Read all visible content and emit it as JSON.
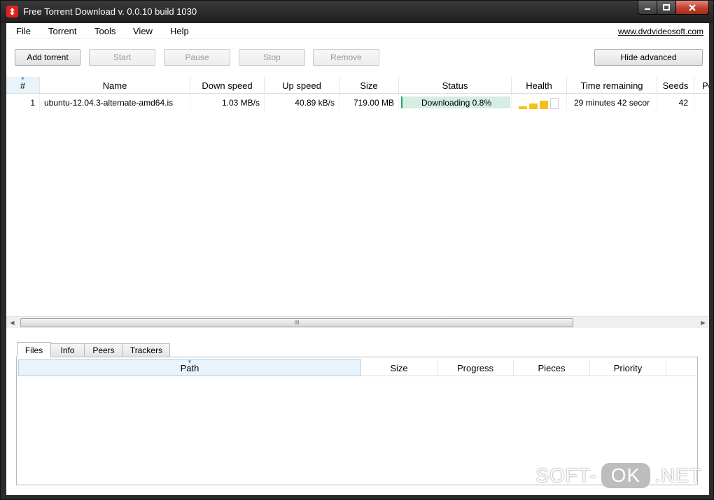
{
  "window": {
    "title": "Free Torrent Download v. 0.0.10 build 1030"
  },
  "menu": {
    "items": [
      "File",
      "Torrent",
      "Tools",
      "View",
      "Help"
    ],
    "site_link": "www.dvdvideosoft.com"
  },
  "toolbar": {
    "add": "Add torrent",
    "start": "Start",
    "pause": "Pause",
    "stop": "Stop",
    "remove": "Remove",
    "hide_advanced": "Hide advanced"
  },
  "torrents": {
    "columns": [
      "#",
      "Name",
      "Down speed",
      "Up speed",
      "Size",
      "Status",
      "Health",
      "Time remaining",
      "Seeds",
      "Pe"
    ],
    "rows": [
      {
        "num": "1",
        "name": "ubuntu-12.04.3-alternate-amd64.is",
        "down": "1.03 MB/s",
        "up": "40.89 kB/s",
        "size": "719.00 MB",
        "status": "Downloading 0.8%",
        "progress": 0.008,
        "health_level": 3,
        "health_max": 4,
        "time": "29 minutes 42 secor",
        "seeds": "42"
      }
    ]
  },
  "scrollbar": {
    "grip": "III"
  },
  "bottom_tabs": [
    "Files",
    "Info",
    "Peers",
    "Trackers"
  ],
  "files": {
    "columns": [
      "Path",
      "Size",
      "Progress",
      "Pieces",
      "Priority"
    ]
  },
  "watermark": {
    "left": "SOFT-",
    "ok": "OK",
    "right": ".NET"
  },
  "colors": {
    "health": "#f3c11b",
    "status_fill": "#d5ede2",
    "close_button": "#c2412c"
  }
}
